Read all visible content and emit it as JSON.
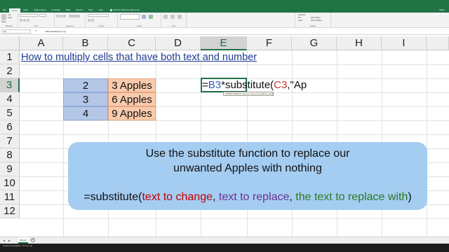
{
  "ribbon_tabs": [
    "File",
    "Home",
    "Insert",
    "Page Layout",
    "Formulas",
    "Data",
    "Review",
    "View",
    "Help"
  ],
  "active_tab_index": 1,
  "tell_me": "Tell me what you want to do",
  "share": "Share",
  "ribbon": {
    "clipboard_cut": "Cut",
    "clipboard_copy": "Copy",
    "clipboard_paste": "Paste",
    "groups": {
      "clipboard": "Clipboard",
      "font": "Font",
      "alignment": "Alignment",
      "number": "Number",
      "styles": "Styles",
      "cells": "Cells",
      "editing": "Editing"
    },
    "autosum": "AutoSum",
    "fill": "Fill",
    "clear": "Clear",
    "sort_filter": "Sort & Filter",
    "find_select": "Find & Select"
  },
  "formula_bar": {
    "name_box": "E3",
    "fx": "fx",
    "content": "=B3*substitute(C3,\"Ap"
  },
  "columns": [
    "A",
    "B",
    "C",
    "D",
    "E",
    "F",
    "G",
    "H",
    "I"
  ],
  "selected_column": "E",
  "rows": [
    "1",
    "2",
    "3",
    "4",
    "5",
    "6",
    "7",
    "8",
    "9",
    "10",
    "11",
    "12"
  ],
  "selected_row": "3",
  "cells": {
    "A1": "How to multiply cells that have both text and number",
    "B3": "2",
    "C3": "3 Apples",
    "B4": "3",
    "C4": "6 Apples",
    "B5": "4",
    "C5": "9 Apples"
  },
  "edit_formula": {
    "eq": "=",
    "ref1": "B3",
    "op": "*substitute(",
    "ref2": "C3",
    "rest": ",\"Ap"
  },
  "tooltip": "SUBSTITUTE(text, old_text, new_text, [instance_num])",
  "callout": {
    "line1": "Use the substitute function to replace our",
    "line2": "unwanted Apples with nothing",
    "syntax_start": "=substitute(",
    "arg1": "text to change",
    "sep1": ", ",
    "arg2": "text to replace",
    "sep2": ", ",
    "arg3": "the text to replace with",
    "syntax_end": ")"
  },
  "sheet_tab": "Sheet1",
  "status": "Ready   Accessibility: Good to go",
  "colors": {
    "excel_green": "#217346",
    "b_fill": "#b4c7e7",
    "c_fill": "#f8cbad",
    "callout": "#a5cdf2"
  }
}
